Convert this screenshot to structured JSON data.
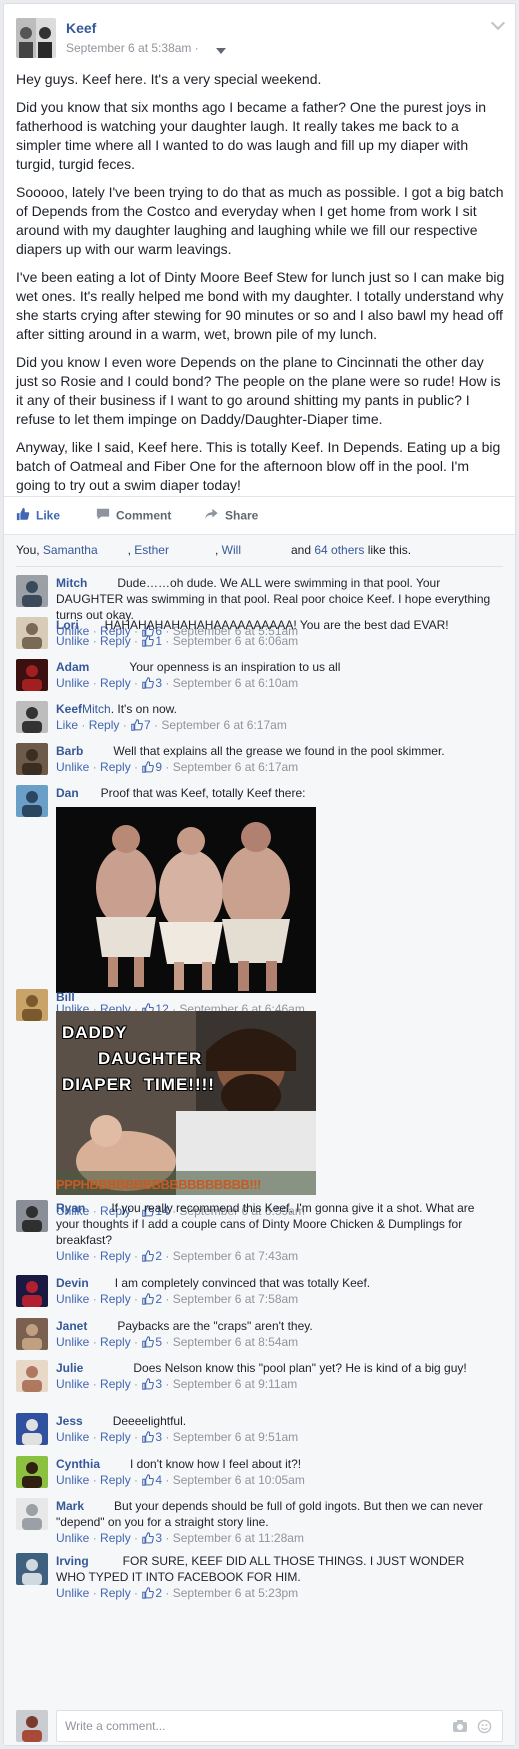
{
  "post": {
    "author": "Keef",
    "timestamp": "September 6 at 5:38am ·",
    "paragraphs": [
      "Hey guys. Keef here. It's a very special weekend.",
      "Did you know that six months ago I became a father? One the purest joys in fatherhood is watching your daughter laugh. It really takes me back to a simpler time where all I wanted to do was laugh and fill up my diaper with turgid, turgid feces.",
      "Sooooo, lately I've been trying to do that as much as possible. I got a big batch of Depends from the Costco and everyday when I get home from work I sit around with my daughter laughing and laughing while we fill our respective diapers up with our warm leavings.",
      "I've been eating a lot of Dinty Moore Beef Stew for lunch just so I can make big wet ones. It's really helped me bond with my daughter. I totally understand why she starts crying after stewing for 90 minutes or so and I also bawl my head off after sitting around in a warm, wet, brown pile of my lunch.",
      "Did you know I even wore Depends on the plane to Cincinnati the other day just so Rosie and I could bond? The people on the plane were so rude! How is it any of their business if I want to go around shitting my pants in public? I refuse to let them impinge on Daddy/Daughter-Diaper time.",
      "Anyway, like I said, Keef here. This is totally Keef. In Depends. Eating up a big batch of Oatmeal and Fiber One for the afternoon blow off in the pool. I'm going to try out a swim diaper today!"
    ]
  },
  "actions": {
    "like": "Like",
    "comment": "Comment",
    "share": "Share"
  },
  "likes": {
    "prefix": "You, ",
    "names": [
      "Samantha",
      "Esther",
      "Will"
    ],
    "sep": ", ",
    "and": "and ",
    "others": "64 others",
    "suffix": " like this."
  },
  "comments": [
    {
      "name": "Mitch",
      "text": "Dude……oh dude. We ALL were swimming in that pool. Your DAUGHTER was swimming in that pool. Real poor choice Keef. I hope everything turns out okay.",
      "like": "Unlike",
      "reply": "Reply",
      "count": "6",
      "time": "September 6 at 5:51am"
    },
    {
      "name": "Lori",
      "text": "HAHAHAHAHAHAHAAAAAAAAAA! You are the best dad EVAR!",
      "like": "Unlike",
      "reply": "Reply",
      "count": "1",
      "time": "September 6 at 6:06am"
    },
    {
      "name": "Adam",
      "text": "Your openness is an inspiration to us all",
      "like": "Unlike",
      "reply": "Reply",
      "count": "3",
      "time": "September 6 at 6:10am"
    },
    {
      "name": "Keef",
      "mention": "Mitch",
      "text": ". It's on now.",
      "like": "Like",
      "reply": "Reply",
      "count": "7",
      "time": "September 6 at 6:17am"
    },
    {
      "name": "Barb",
      "text": "Well that explains all the grease we found in the pool skimmer.",
      "like": "Unlike",
      "reply": "Reply",
      "count": "9",
      "time": "September 6 at 6:17am"
    },
    {
      "name": "Dan",
      "text": "Proof that was Keef, totally Keef there:",
      "like": "Unlike",
      "reply": "Reply",
      "count": "12",
      "time": "September 6 at 6:46am"
    },
    {
      "name": "Bill",
      "text": "",
      "image_caption": "DADDY DAUGHTER DIAPER TIME!!!!",
      "image_caption_lines": [
        "DADDY",
        "DAUGHTER",
        "DIAPER  TIME!!!!"
      ],
      "image_bottom": "PPPHBBBBBBBBBBBBBBBBBB!!!",
      "like": "Unlike",
      "reply": "Reply",
      "count": "14",
      "time": "September 6 at 6:59am"
    },
    {
      "name": "Ryan",
      "text": "If you really recommend this Keef, I'm gonna give it a shot. What are your thoughts if I add a couple cans of Dinty Moore Chicken & Dumplings for breakfast?",
      "like": "Unlike",
      "reply": "Reply",
      "count": "2",
      "time": "September 6 at 7:43am"
    },
    {
      "name": "Devin",
      "text": "I am completely convinced that was totally Keef.",
      "like": "Unlike",
      "reply": "Reply",
      "count": "2",
      "time": "September 6 at 7:58am"
    },
    {
      "name": "Janet",
      "text": "Paybacks are the \"craps\" aren't they.",
      "like": "Unlike",
      "reply": "Reply",
      "count": "5",
      "time": "September 6 at 8:54am"
    },
    {
      "name": "Julie",
      "text": "Does Nelson know this \"pool plan\" yet? He is kind of a big guy!",
      "like": "Unlike",
      "reply": "Reply",
      "count": "3",
      "time": "September 6 at 9:11am"
    },
    {
      "name": "Jess",
      "text": "Deeeelightful.",
      "like": "Unlike",
      "reply": "Reply",
      "count": "3",
      "time": "September 6 at 9:51am"
    },
    {
      "name": "Cynthia",
      "text": "I don't know how I feel about it?!",
      "like": "Unlike",
      "reply": "Reply",
      "count": "4",
      "time": "September 6 at 10:05am"
    },
    {
      "name": "Mark",
      "text": "But your depends should be full of gold ingots. But then we can never \"depend\" on you for a straight story line.",
      "like": "Unlike",
      "reply": "Reply",
      "count": "3",
      "time": "September 6 at 11:28am"
    },
    {
      "name": "Irving",
      "text": "FOR SURE, KEEF DID ALL THOSE THINGS. I JUST WONDER WHO TYPED IT INTO FACEBOOK FOR HIM.",
      "like": "Unlike",
      "reply": "Reply",
      "count": "2",
      "time": "September 6 at 5:23pm"
    }
  ],
  "composer": {
    "placeholder": "Write a comment..."
  },
  "meta_sep": " · ",
  "colors": {
    "link": "#365899",
    "accent": "#4267b2",
    "muted": "#90949c"
  }
}
